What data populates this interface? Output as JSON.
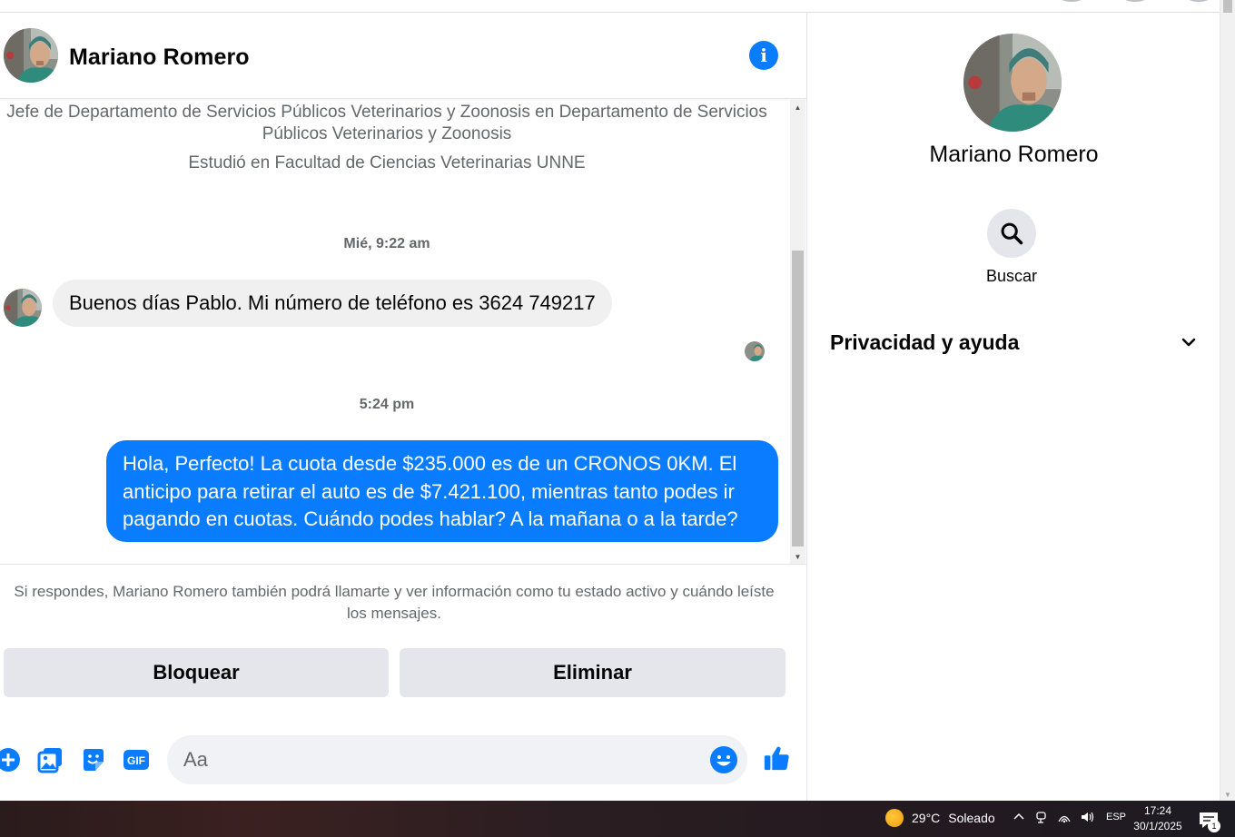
{
  "chat": {
    "contact_name": "Mariano Romero",
    "profile_job": "Jefe de Departamento de Servicios Públicos Veterinarios y Zoonosis en Departamento de Servicios Públicos Veterinarios y Zoonosis",
    "profile_study": "Estudió en Facultad de Ciencias Veterinarias UNNE",
    "messages": [
      {
        "timestamp": "Mié, 9:22 am",
        "direction": "incoming",
        "text": "Buenos días Pablo. Mi número de teléfono es 3624 749217"
      },
      {
        "timestamp": "5:24 pm",
        "direction": "outgoing",
        "text": "Hola, Perfecto! La cuota desde $235.000 es de un CRONOS 0KM. El anticipo para retirar el auto es de $7.421.100, mientras tanto podes ir pagando en cuotas. Cuándo podes hablar? A la mañana o a la tarde?"
      }
    ],
    "notice": "Si respondes, Mariano Romero también podrá llamarte y ver información como tu estado activo y cuándo leíste los mensajes.",
    "block_label": "Bloquear",
    "delete_label": "Eliminar",
    "composer_placeholder": "Aa",
    "composer_icons": [
      "plus-circle-icon",
      "photo-icon",
      "sticker-icon",
      "gif-icon",
      "emoji-icon",
      "thumbs-up-icon"
    ],
    "accent_color": "#0a7cff"
  },
  "side_panel": {
    "name": "Mariano Romero",
    "search_label": "Buscar",
    "privacy_label": "Privacidad y ayuda"
  },
  "taskbar": {
    "temperature": "29°C",
    "weather": "Soleado",
    "language": "ESP",
    "time": "17:24",
    "date": "30/1/2025",
    "notification_count": "1"
  }
}
